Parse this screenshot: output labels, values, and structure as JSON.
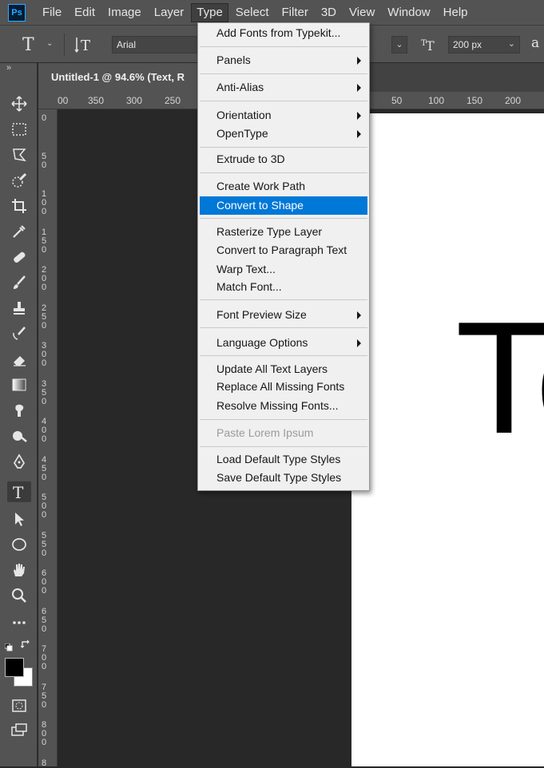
{
  "app": {
    "logo_text": "Ps"
  },
  "menubar": {
    "items": [
      "File",
      "Edit",
      "Image",
      "Layer",
      "Type",
      "Select",
      "Filter",
      "3D",
      "View",
      "Window",
      "Help"
    ],
    "active": "Type"
  },
  "options_bar": {
    "font_family": "Arial",
    "font_size": "200 px",
    "tool_letter": "T",
    "aa_glyph": "a"
  },
  "document": {
    "tab_title": "Untitled-1 @ 94.6% (Text, R",
    "canvas_text": "Te"
  },
  "rulers": {
    "top_ticks": [
      "00",
      "350",
      "300",
      "250",
      "50",
      "100",
      "150",
      "200"
    ],
    "left_ticks": [
      "0",
      "5\n0",
      "1\n0\n0",
      "1\n5\n0",
      "2\n0\n0",
      "2\n5\n0",
      "3\n0\n0",
      "3\n5\n0",
      "4\n0\n0",
      "4\n5\n0",
      "5\n0\n0",
      "5\n5\n0",
      "6\n0\n0",
      "6\n5\n0",
      "7\n0\n0",
      "7\n5\n0",
      "8\n0\n0",
      "8"
    ]
  },
  "type_menu": {
    "items": {
      "add_fonts": "Add Fonts from Typekit...",
      "panels": "Panels",
      "anti_alias": "Anti-Alias",
      "orientation": "Orientation",
      "opentype": "OpenType",
      "extrude": "Extrude to 3D",
      "create_work_path": "Create Work Path",
      "convert_to_shape": "Convert to Shape",
      "rasterize": "Rasterize Type Layer",
      "convert_paragraph": "Convert to Paragraph Text",
      "warp_text": "Warp Text...",
      "match_font": "Match Font...",
      "font_preview": "Font Preview Size",
      "language_options": "Language Options",
      "update_all": "Update All Text Layers",
      "replace_missing": "Replace All Missing Fonts",
      "resolve_missing": "Resolve Missing Fonts...",
      "paste_lorem": "Paste Lorem Ipsum",
      "load_default": "Load Default Type Styles",
      "save_default": "Save Default Type Styles"
    },
    "highlighted": "Convert to Shape",
    "disabled": [
      "Paste Lorem Ipsum"
    ]
  },
  "colors": {
    "highlight": "#0078d7",
    "menu_bg": "#f0f0f0",
    "ui_bg": "#535353"
  }
}
